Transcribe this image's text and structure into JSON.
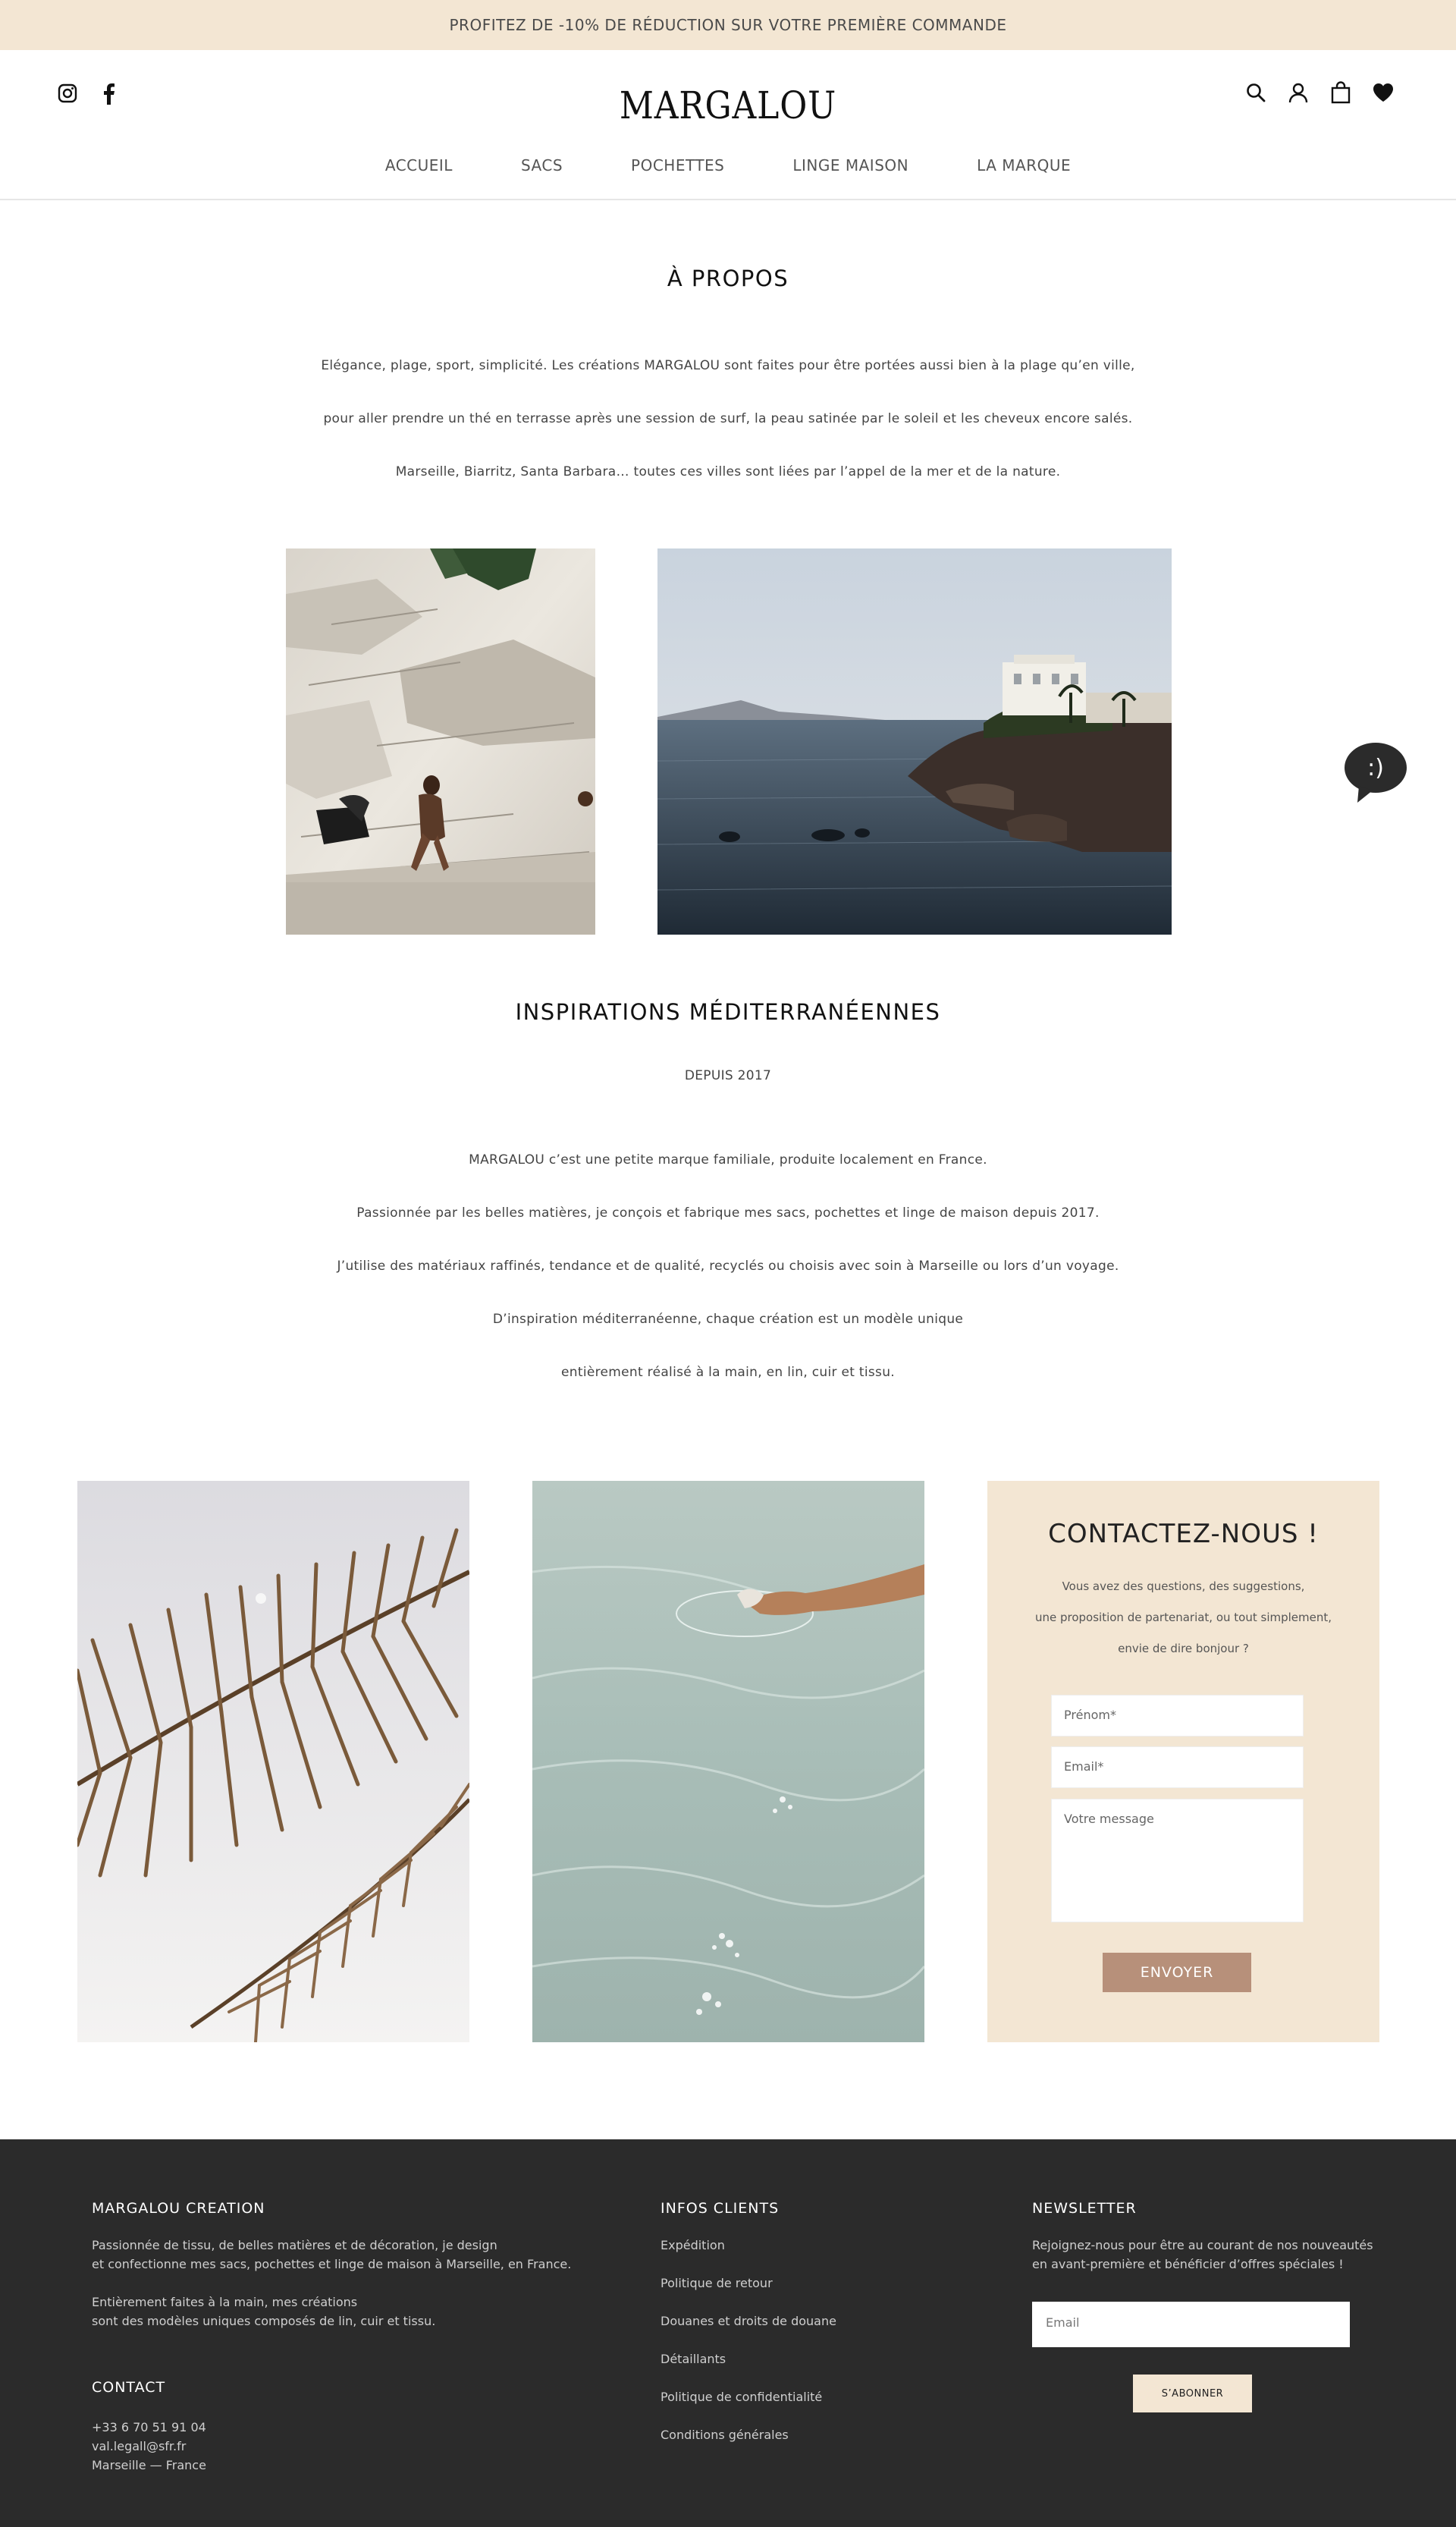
{
  "promo": {
    "text": "PROFITEZ DE -10% DE RÉDUCTION SUR VOTRE PREMIÈRE COMMANDE"
  },
  "header": {
    "logo": "MARGALOU",
    "social": [
      "instagram-icon",
      "facebook-icon"
    ],
    "tools": [
      "search-icon",
      "user-icon",
      "bag-icon",
      "heart-icon"
    ]
  },
  "nav": {
    "items": [
      "ACCUEIL",
      "SACS",
      "POCHETTES",
      "LINGE MAISON",
      "LA MARQUE"
    ]
  },
  "about": {
    "title": "À PROPOS",
    "lines": [
      "Elégance, plage, sport, simplicité. Les créations MARGALOU sont faites pour être portées aussi bien à la plage qu’en ville,",
      "pour aller prendre un thé en terrasse après une session de surf, la peau satinée par le soleil et les cheveux encore salés.",
      "Marseille, Biarritz, Santa Barbara… toutes ces villes sont liées par l’appel de la mer et de la nature."
    ]
  },
  "inspirations": {
    "title": "INSPIRATIONS MÉDITERRANÉENNES",
    "subtitle": "DEPUIS 2017",
    "lines": [
      "MARGALOU c’est une petite marque familiale, produite localement en France.",
      "Passionnée par les belles matières, je conçois et fabrique mes sacs, pochettes et linge de maison depuis 2017.",
      "J’utilise des matériaux raffinés, tendance et de qualité, recyclés ou choisis avec soin à Marseille ou lors d’un voyage.",
      "D’inspiration méditerranéenne, chaque création est un modèle unique",
      "entièrement réalisé à la main, en lin, cuir et tissu."
    ]
  },
  "chat": {
    "glyph": ":)"
  },
  "contact": {
    "title": "CONTACTEZ-NOUS !",
    "lines": [
      "Vous avez des questions, des suggestions,",
      "une proposition de partenariat, ou tout simplement,",
      "envie de dire bonjour ?"
    ],
    "firstname_placeholder": "Prénom*",
    "email_placeholder": "Email*",
    "message_placeholder": "Votre message",
    "send_label": "ENVOYER"
  },
  "footer": {
    "about_title": "MARGALOU CREATION",
    "about_lines": [
      "Passionnée de tissu, de belles matières et de décoration, je design",
      "et confectionne mes sacs, pochettes et linge de maison à Marseille, en France.",
      "Entièrement faites à la main, mes créations",
      "sont des modèles uniques composés de lin, cuir et tissu."
    ],
    "contact_title": "CONTACT",
    "contact_lines": [
      "+33 6 70 51 91 04",
      "val.legall@sfr.fr",
      "Marseille — France"
    ],
    "info_title": "INFOS CLIENTS",
    "info_links": [
      "Expédition",
      "Politique de retour",
      "Douanes et droits de douane",
      "Détaillants",
      "Politique de confidentialité",
      "Conditions générales"
    ],
    "newsletter_title": "NEWSLETTER",
    "newsletter_lines": [
      "Rejoignez-nous pour être au courant de nos nouveautés",
      "en avant-première et bénéficier d’offres spéciales !"
    ],
    "newsletter_placeholder": "Email",
    "subscribe_label": "S’ABONNER"
  }
}
